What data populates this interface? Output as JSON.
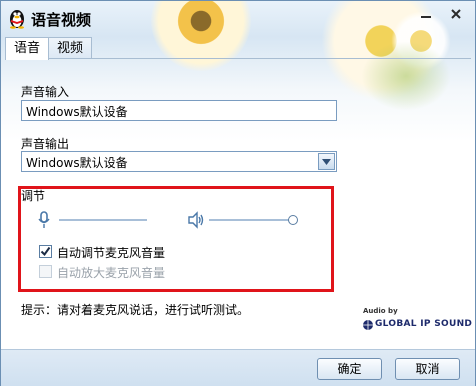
{
  "window": {
    "title": "语音视频"
  },
  "titlebar": {
    "minimize_icon": "minimize-icon",
    "close_icon": "close-icon"
  },
  "tabs": [
    {
      "label": "语音",
      "active": true
    },
    {
      "label": "视频",
      "active": false
    }
  ],
  "audio_input": {
    "label": "声音输入",
    "value": "Windows默认设备"
  },
  "audio_output": {
    "label": "声音输出",
    "value": "Windows默认设备"
  },
  "adjust": {
    "label": "调节",
    "mic_icon": "microphone-icon",
    "speaker_icon": "speaker-icon",
    "mic_level": 0.0,
    "speaker_level": 1.0,
    "auto_adjust_mic": {
      "label": "自动调节麦克风音量",
      "checked": true,
      "enabled": true
    },
    "auto_amplify_mic": {
      "label": "自动放大麦克风音量",
      "checked": false,
      "enabled": false
    }
  },
  "hint": "提示：请对着麦克风说话，进行试听测试。",
  "branding": {
    "audio_by": "Audio by",
    "brand": "GLOBAL IP SOUND"
  },
  "footer": {
    "ok_label": "确定",
    "cancel_label": "取消"
  },
  "colors": {
    "highlight_border": "#e0141a",
    "accent": "#4a78a8"
  }
}
